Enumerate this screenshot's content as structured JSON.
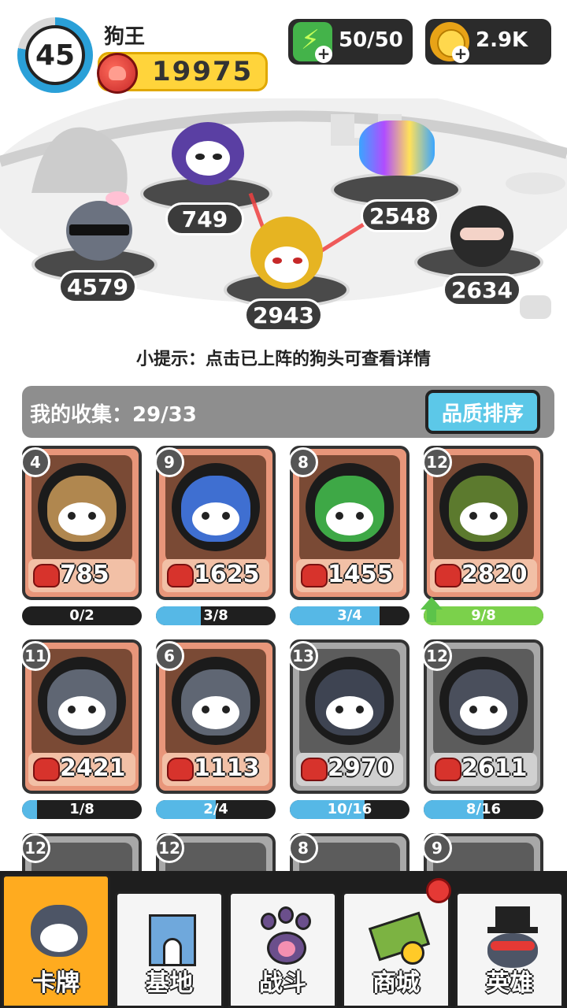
{
  "player": {
    "level": "45",
    "level_progress": 0.78,
    "name": "狗王",
    "power": "19975"
  },
  "resources": {
    "energy": "50/50",
    "coins": "2.9K",
    "energy_icon": "lightning-icon",
    "coin_icon": "coin-icon"
  },
  "arena": {
    "slots": [
      {
        "value": "4579"
      },
      {
        "value": "749"
      },
      {
        "value": "2943"
      },
      {
        "value": "2548"
      },
      {
        "value": "2634"
      }
    ]
  },
  "tip": "小提示：点击已上阵的狗头可查看详情",
  "collection": {
    "label": "我的收集：29/33",
    "sort_button": "品质排序"
  },
  "cards": [
    {
      "level": "4",
      "value": "785",
      "progress": "0/2",
      "fill": 0.0,
      "rarity": "bronze",
      "color": "#b0874f"
    },
    {
      "level": "9",
      "value": "1625",
      "progress": "3/8",
      "fill": 0.375,
      "rarity": "bronze",
      "color": "#3f6fd1"
    },
    {
      "level": "8",
      "value": "1455",
      "progress": "3/4",
      "fill": 0.75,
      "rarity": "bronze",
      "color": "#3ea846"
    },
    {
      "level": "12",
      "value": "2820",
      "progress": "9/8",
      "fill": 1.0,
      "rarity": "bronze",
      "color": "#5c7a2e",
      "upgrade": true
    },
    {
      "level": "11",
      "value": "2421",
      "progress": "1/8",
      "fill": 0.125,
      "rarity": "bronze",
      "color": "#5f6673"
    },
    {
      "level": "6",
      "value": "1113",
      "progress": "2/4",
      "fill": 0.5,
      "rarity": "bronze",
      "color": "#5f6673"
    },
    {
      "level": "13",
      "value": "2970",
      "progress": "10/16",
      "fill": 0.625,
      "rarity": "silver",
      "color": "#3e4452"
    },
    {
      "level": "12",
      "value": "2611",
      "progress": "8/16",
      "fill": 0.5,
      "rarity": "silver",
      "color": "#4a4f5c"
    }
  ],
  "peek_cards": [
    {
      "level": "12"
    },
    {
      "level": "12"
    },
    {
      "level": "8"
    },
    {
      "level": "9"
    }
  ],
  "nav": [
    {
      "label": "卡牌",
      "icon": "husky-card-icon",
      "active": true
    },
    {
      "label": "基地",
      "icon": "castle-icon",
      "active": false
    },
    {
      "label": "战斗",
      "icon": "paw-icon",
      "active": false
    },
    {
      "label": "商城",
      "icon": "money-icon",
      "active": false,
      "badge": true
    },
    {
      "label": "英雄",
      "icon": "top-hat-dog-icon",
      "active": false
    }
  ]
}
